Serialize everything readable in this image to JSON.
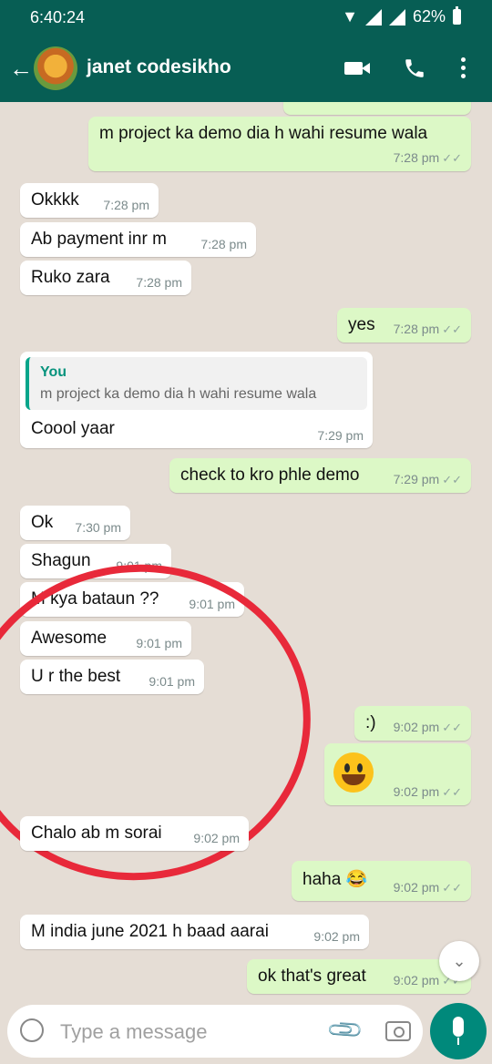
{
  "status_bar": {
    "time": "6:40:24",
    "battery": "62%"
  },
  "header": {
    "contact_name": "janet codesikho",
    "back_icon": "arrow-left-icon",
    "video_icon": "video-call-icon",
    "call_icon": "phone-icon",
    "menu_icon": "more-vert-icon"
  },
  "messages": [
    {
      "dir": "out",
      "text": "m project ka demo dia h wahi resume wala",
      "time": "7:28 pm",
      "ticks": "✓✓"
    },
    {
      "dir": "in",
      "text": "Okkkk",
      "time": "7:28 pm"
    },
    {
      "dir": "in",
      "text": "Ab payment inr m",
      "time": "7:28 pm"
    },
    {
      "dir": "in",
      "text": "Ruko zara",
      "time": "7:28 pm"
    },
    {
      "dir": "out",
      "text": "yes",
      "time": "7:28 pm",
      "ticks": "✓✓"
    },
    {
      "dir": "in",
      "quote_name": "You",
      "quote_text": "m project ka demo dia h wahi resume wala",
      "text": "Coool yaar",
      "time": "7:29 pm"
    },
    {
      "dir": "out",
      "text": "check to kro phle demo",
      "time": "7:29 pm",
      "ticks": "✓✓"
    },
    {
      "dir": "in",
      "text": "Ok",
      "time": "7:30 pm"
    },
    {
      "dir": "in",
      "text": "Shagun",
      "time": "9:01 pm"
    },
    {
      "dir": "in",
      "text": "M kya bataun ??",
      "time": "9:01 pm"
    },
    {
      "dir": "in",
      "text": "Awesome",
      "time": "9:01 pm"
    },
    {
      "dir": "in",
      "text": "U r the best",
      "time": "9:01 pm"
    },
    {
      "dir": "out",
      "text": ":)",
      "time": "9:02 pm",
      "ticks": "✓✓"
    },
    {
      "dir": "out",
      "emoji": "grinning-face-emoji",
      "time": "9:02 pm",
      "ticks": "✓✓"
    },
    {
      "dir": "in",
      "text": "Chalo ab m sorai",
      "time": "9:02 pm"
    },
    {
      "dir": "out",
      "text": "haha 😂",
      "time": "9:02 pm",
      "ticks": "✓✓"
    },
    {
      "dir": "in",
      "text": "M india june 2021 h baad aarai",
      "time": "9:02 pm"
    },
    {
      "dir": "out",
      "text": "ok that's great",
      "time": "9:02 pm",
      "ticks": "✓✓"
    }
  ],
  "composer": {
    "placeholder": "Type a message"
  },
  "colors": {
    "header": "#075e54",
    "outgoing_bubble": "#dcf8c6",
    "incoming_bubble": "#ffffff",
    "annotation": "#e8293a",
    "fab": "#00897b"
  }
}
